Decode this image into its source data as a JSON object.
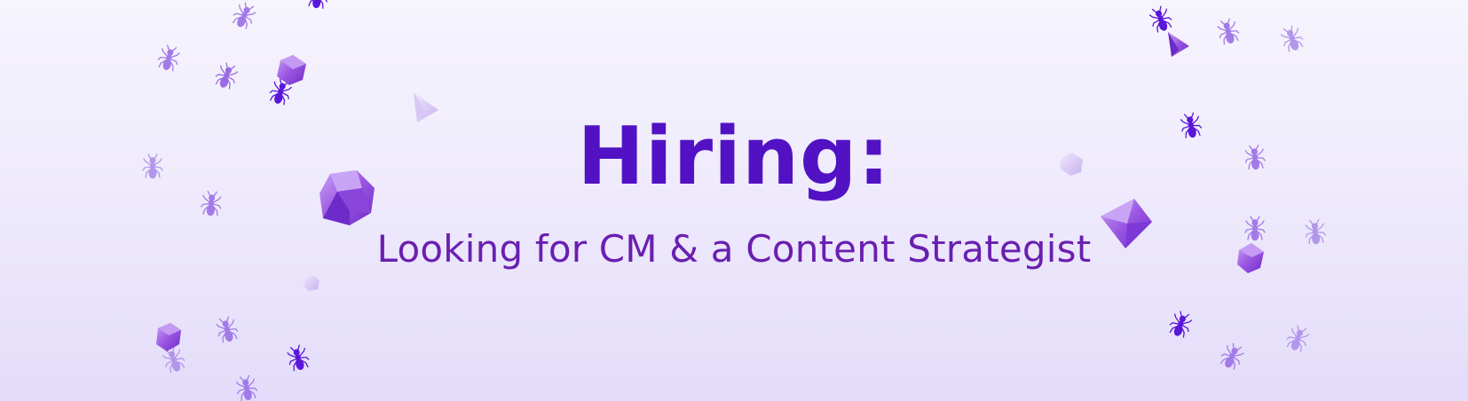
{
  "banner": {
    "title": "Hiring:",
    "subtitle": "Looking for CM & a Content Strategist"
  },
  "colors": {
    "title": "#5212c4",
    "subtitle": "#6a1fb0",
    "ant_dark": "#5a16d9",
    "ant_light": "#a27be8",
    "gem": "#9a55e0",
    "background_top": "#f6f4fd",
    "background_bottom": "#e3dcfa"
  },
  "decorations": {
    "icons": [
      "ant-icon",
      "gem-icon",
      "cube-icon",
      "cone-icon"
    ]
  }
}
